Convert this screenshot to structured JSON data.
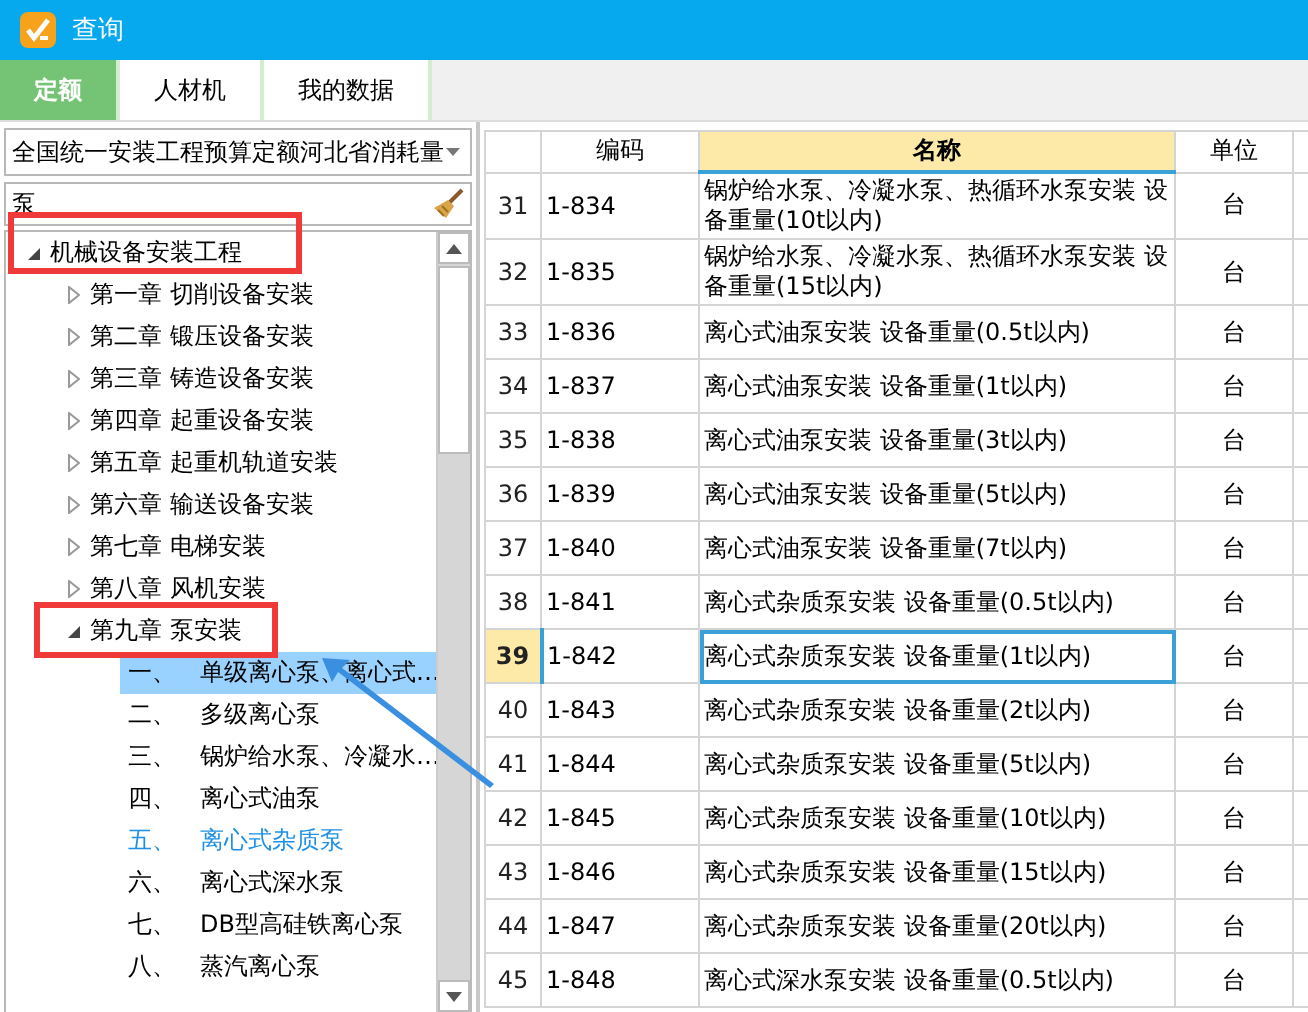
{
  "window": {
    "title": "查询"
  },
  "tabs": [
    {
      "label": "定额",
      "selected": true
    },
    {
      "label": "人材机",
      "selected": false
    },
    {
      "label": "我的数据",
      "selected": false
    }
  ],
  "library_dropdown": {
    "value": "全国统一安装工程预算定额河北省消耗量"
  },
  "search": {
    "value": "泵"
  },
  "tree": {
    "label": "机械设备安装工程",
    "expanded": true,
    "children": [
      {
        "label": "第一章  切削设备安装",
        "expanded": false
      },
      {
        "label": "第二章  锻压设备安装",
        "expanded": false
      },
      {
        "label": "第三章  铸造设备安装",
        "expanded": false
      },
      {
        "label": "第四章  起重设备安装",
        "expanded": false
      },
      {
        "label": "第五章  起重机轨道安装",
        "expanded": false
      },
      {
        "label": "第六章  输送设备安装",
        "expanded": false
      },
      {
        "label": "第七章  电梯安装",
        "expanded": false
      },
      {
        "label": "第八章  风机安装",
        "expanded": false
      },
      {
        "label": "第九章  泵安装",
        "expanded": true,
        "children": [
          {
            "number": "一、",
            "label": "单级离心泵、离心式…",
            "selected": true,
            "current": false
          },
          {
            "number": "二、",
            "label": "多级离心泵",
            "selected": false,
            "current": false
          },
          {
            "number": "三、",
            "label": "锅炉给水泵、冷凝水…",
            "selected": false,
            "current": false
          },
          {
            "number": "四、",
            "label": "离心式油泵",
            "selected": false,
            "current": false
          },
          {
            "number": "五、",
            "label": "离心式杂质泵",
            "selected": false,
            "current": true
          },
          {
            "number": "六、",
            "label": "离心式深水泵",
            "selected": false,
            "current": false
          },
          {
            "number": "七、",
            "label": "DB型高硅铁离心泵",
            "selected": false,
            "current": false
          },
          {
            "number": "八、",
            "label": "蒸汽离心泵",
            "selected": false,
            "current": false
          }
        ]
      }
    ]
  },
  "table": {
    "columns": [
      {
        "label": "编码",
        "active": false
      },
      {
        "label": "名称",
        "active": true
      },
      {
        "label": "单位",
        "active": false
      }
    ],
    "rows": [
      {
        "number": "31",
        "code": "1-834",
        "name": "锅炉给水泵、冷凝水泵、热循环水泵安装 设备重量(10t以内)",
        "unit": "台",
        "selected": false
      },
      {
        "number": "32",
        "code": "1-835",
        "name": "锅炉给水泵、冷凝水泵、热循环水泵安装 设备重量(15t以内)",
        "unit": "台",
        "selected": false
      },
      {
        "number": "33",
        "code": "1-836",
        "name": "离心式油泵安装 设备重量(0.5t以内)",
        "unit": "台",
        "selected": false
      },
      {
        "number": "34",
        "code": "1-837",
        "name": "离心式油泵安装 设备重量(1t以内)",
        "unit": "台",
        "selected": false
      },
      {
        "number": "35",
        "code": "1-838",
        "name": "离心式油泵安装 设备重量(3t以内)",
        "unit": "台",
        "selected": false
      },
      {
        "number": "36",
        "code": "1-839",
        "name": "离心式油泵安装 设备重量(5t以内)",
        "unit": "台",
        "selected": false
      },
      {
        "number": "37",
        "code": "1-840",
        "name": "离心式油泵安装 设备重量(7t以内)",
        "unit": "台",
        "selected": false
      },
      {
        "number": "38",
        "code": "1-841",
        "name": "离心式杂质泵安装 设备重量(0.5t以内)",
        "unit": "台",
        "selected": false
      },
      {
        "number": "39",
        "code": "1-842",
        "name": "离心式杂质泵安装 设备重量(1t以内)",
        "unit": "台",
        "selected": true
      },
      {
        "number": "40",
        "code": "1-843",
        "name": "离心式杂质泵安装 设备重量(2t以内)",
        "unit": "台",
        "selected": false
      },
      {
        "number": "41",
        "code": "1-844",
        "name": "离心式杂质泵安装 设备重量(5t以内)",
        "unit": "台",
        "selected": false
      },
      {
        "number": "42",
        "code": "1-845",
        "name": "离心式杂质泵安装 设备重量(10t以内)",
        "unit": "台",
        "selected": false
      },
      {
        "number": "43",
        "code": "1-846",
        "name": "离心式杂质泵安装 设备重量(15t以内)",
        "unit": "台",
        "selected": false
      },
      {
        "number": "44",
        "code": "1-847",
        "name": "离心式杂质泵安装 设备重量(20t以内)",
        "unit": "台",
        "selected": false
      },
      {
        "number": "45",
        "code": "1-848",
        "name": "离心式深水泵安装 设备重量(0.5t以内)",
        "unit": "台",
        "selected": false
      }
    ]
  }
}
